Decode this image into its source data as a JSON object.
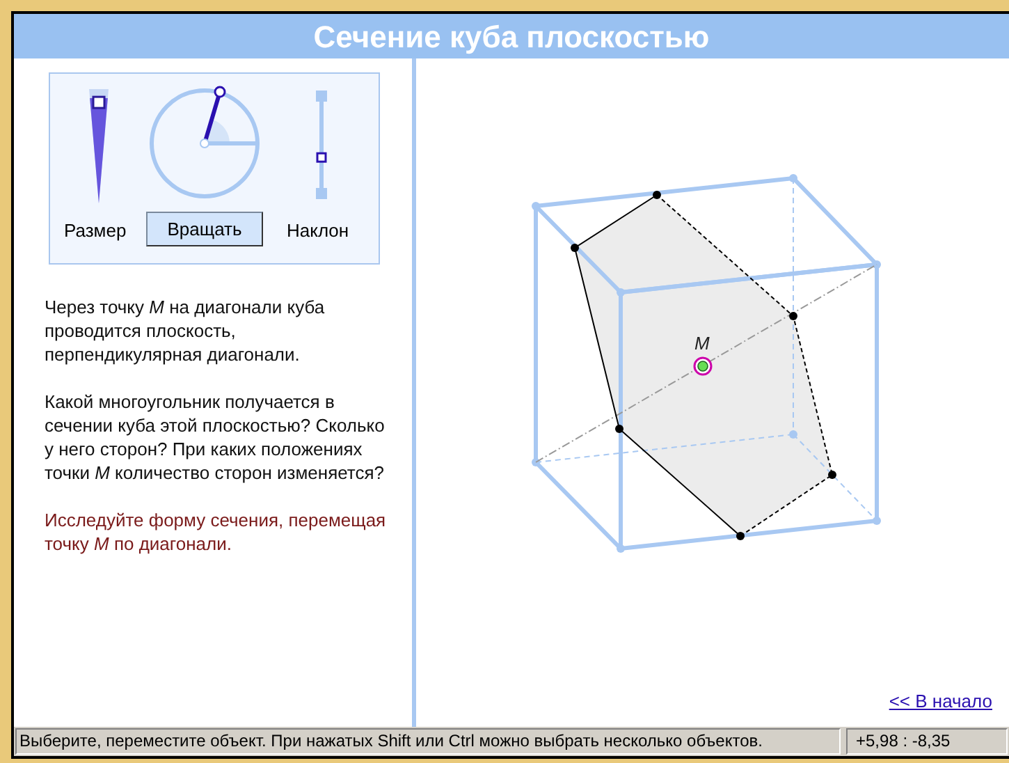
{
  "window": {
    "title": "Сечение куба плоскостью"
  },
  "controls": {
    "size": {
      "label": "Размер",
      "level": 0.92
    },
    "rotate": {
      "button": "Вращать"
    },
    "tilt": {
      "label": "Наклон",
      "level": 0.37
    }
  },
  "description": [
    "Через точку *M* на диагонали куба проводится плоскость, перпендикулярная диагонали.",
    "Какой многоугольник получается в сечении куба этой плоскостью? Сколько у него сторон? При каких положениях точки *M* количество сторон изменяется?"
  ],
  "hint": "Исследуйте форму сечения, перемещая точку *M* по диагонали.",
  "canvas": {
    "point_label": "M"
  },
  "link": "<< В начало",
  "status_bar": {
    "message": "Выберите, переместите объект. При нажатых Shift или Ctrl можно выбрать несколько объектов.",
    "coordinates": "+5,98 : -8,35"
  }
}
